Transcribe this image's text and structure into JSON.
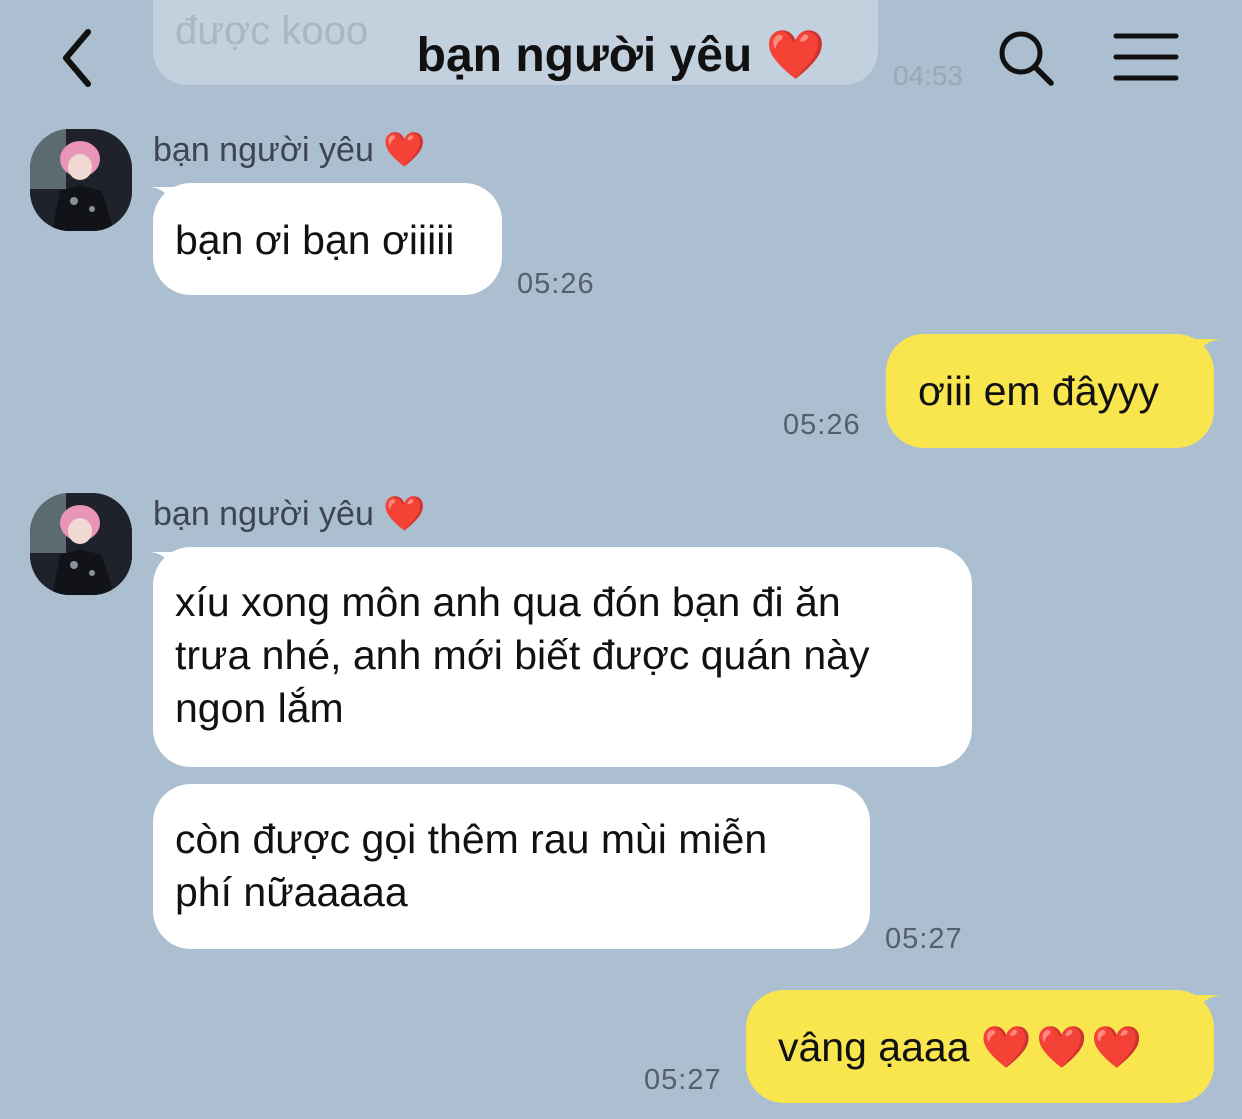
{
  "header": {
    "title": "bạn người yêu",
    "title_emoji": "❤️",
    "back_icon": "chevron-left-icon",
    "search_icon": "search-icon",
    "menu_icon": "menu-icon"
  },
  "previous_message": {
    "text": "được kooo",
    "time": "04:53"
  },
  "messages": [
    {
      "sender": "bạn người yêu",
      "sender_emoji": "❤️",
      "direction": "in",
      "text": "bạn ơi bạn ơiiiii",
      "time": "05:26"
    },
    {
      "direction": "out",
      "text": "ơiii em đâyyy",
      "time": "05:26"
    },
    {
      "sender": "bạn người yêu",
      "sender_emoji": "❤️",
      "direction": "in",
      "lines": [
        "xíu xong môn anh qua đón bạn đi ăn",
        "trưa nhé, anh mới biết được quán này",
        "ngon lắm"
      ]
    },
    {
      "direction": "in",
      "lines": [
        "còn được gọi thêm rau mùi miễn",
        "phí nữaaaaa"
      ],
      "time": "05:27"
    },
    {
      "direction": "out",
      "text": "vâng ạaaa",
      "hearts": "❤️",
      "time": "05:27"
    }
  ],
  "colors": {
    "background": "#abbfd0",
    "incoming_bubble": "#ffffff",
    "outgoing_bubble": "#f9e54e",
    "heart": "#e0303a"
  }
}
